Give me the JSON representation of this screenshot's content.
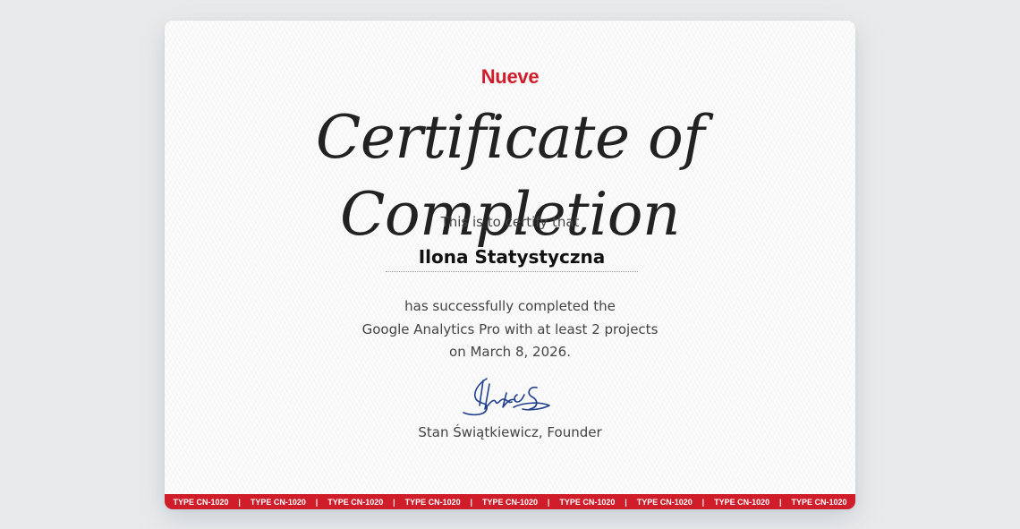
{
  "certificate": {
    "brand": "Nueve",
    "title": "Certificate of Completion",
    "intro": "This is to certify that",
    "recipient": "Ilona Statystyczna",
    "body_lines": [
      "has successfully completed the",
      "Google Analytics Pro with at least 2 projects",
      "on March 8, 2026."
    ],
    "signer": "Stan Świątkiewicz, Founder",
    "strip_text": "TYPE CN-1020",
    "strip_repeat": 9,
    "strip_separator": "|"
  },
  "colors": {
    "brand": "#d01d2a",
    "strip": "#d01d2a",
    "signature_ink": "#1f3f8f",
    "background": "#e9eaeb"
  },
  "icons": {
    "signature": "handwritten-signature"
  }
}
